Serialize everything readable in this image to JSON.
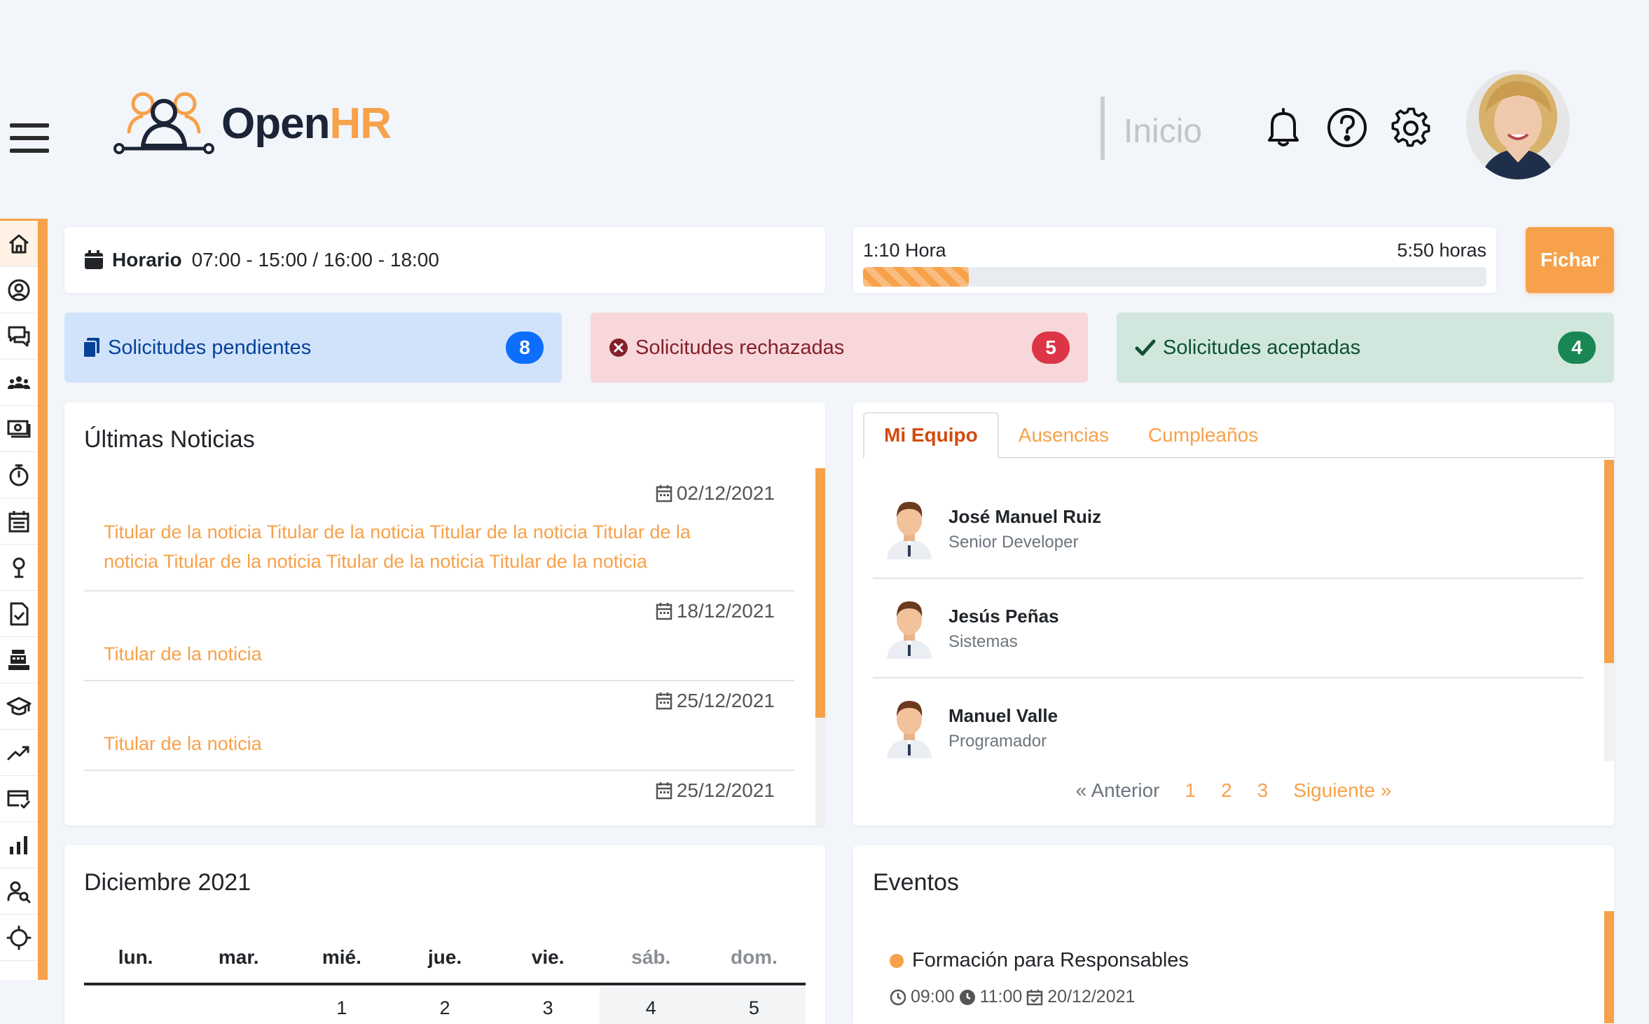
{
  "header": {
    "logo_text_main": "Open",
    "logo_text_accent": "HR",
    "page_label": "Inicio",
    "icons": [
      "bell-icon",
      "help-icon",
      "gear-icon"
    ]
  },
  "sidebar": {
    "items": [
      "home-icon",
      "user-circle-icon",
      "chat-icon",
      "team-icon",
      "payroll-icon",
      "stopwatch-icon",
      "calendar-icon",
      "location-icon",
      "document-check-icon",
      "cash-register-icon",
      "graduation-icon",
      "trend-icon",
      "card-check-icon",
      "bar-chart-icon",
      "user-search-icon",
      "target-icon"
    ]
  },
  "schedule": {
    "label": "Horario",
    "value": "07:00 - 15:00 / 16:00 - 18:00"
  },
  "timer": {
    "worked": "1:10 Hora",
    "remaining": "5:50 horas",
    "progress_fraction": 0.17,
    "button": "Fichar"
  },
  "requests": {
    "pending": {
      "label": "Solicitudes pendientes",
      "count": "8"
    },
    "rejected": {
      "label": "Solicitudes rechazadas",
      "count": "5"
    },
    "accepted": {
      "label": "Solicitudes aceptadas",
      "count": "4"
    }
  },
  "news": {
    "title": "Últimas Noticias",
    "items": [
      {
        "date": "02/12/2021",
        "headline_line1": "Titular de la noticia Titular de la noticia Titular de la noticia Titular de la",
        "headline_line2": "noticia Titular de la noticia Titular de la noticia Titular de la noticia"
      },
      {
        "date": "18/12/2021",
        "headline": "Titular de la noticia"
      },
      {
        "date": "25/12/2021",
        "headline": "Titular de la noticia"
      },
      {
        "date": "25/12/2021"
      }
    ]
  },
  "team": {
    "tabs": [
      "Mi Equipo",
      "Ausencias",
      "Cumpleaños"
    ],
    "members": [
      {
        "name": "José Manuel Ruiz",
        "role": "Senior Developer"
      },
      {
        "name": "Jesús Peñas",
        "role": "Sistemas"
      },
      {
        "name": "Manuel Valle",
        "role": "Programador"
      }
    ],
    "pager": {
      "prev": "« Anterior",
      "pages": [
        "1",
        "2",
        "3"
      ],
      "next": "Siguiente »"
    }
  },
  "calendar": {
    "title": "Diciembre 2021",
    "weekdays": [
      "lun.",
      "mar.",
      "mié.",
      "jue.",
      "vie.",
      "sáb.",
      "dom."
    ],
    "first_row": [
      "",
      "",
      "1",
      "2",
      "3",
      "4",
      "5"
    ]
  },
  "events": {
    "title": "Eventos",
    "items": [
      {
        "name": "Formación para Responsables",
        "start": "09:00",
        "end": "11:00",
        "date": "20/12/2021"
      }
    ]
  },
  "colors": {
    "accent": "#f7a14a",
    "dark": "#1c2438",
    "pending": "#0d6efd",
    "rejected": "#dc3545",
    "accepted": "#198754"
  }
}
